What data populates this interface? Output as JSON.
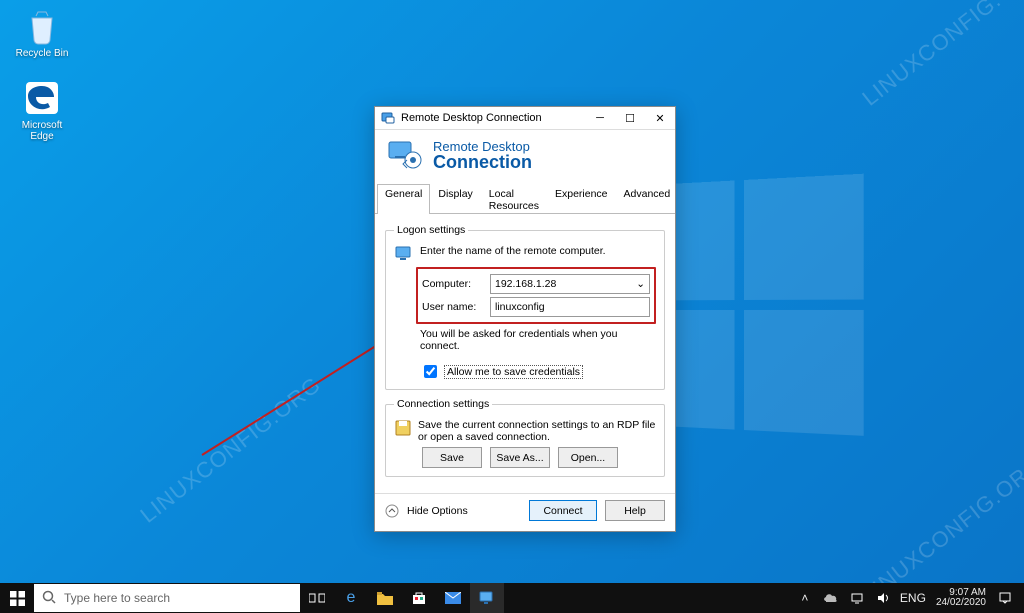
{
  "watermark": "LINUXCONFIG.ORG",
  "desktop_icons": [
    {
      "name": "Recycle Bin"
    },
    {
      "name": "Microsoft Edge"
    }
  ],
  "window": {
    "title": "Remote Desktop Connection",
    "banner_line1": "Remote Desktop",
    "banner_line2": "Connection",
    "tabs": [
      "General",
      "Display",
      "Local Resources",
      "Experience",
      "Advanced"
    ],
    "logon": {
      "legend": "Logon settings",
      "instr": "Enter the name of the remote computer.",
      "computer_label": "Computer:",
      "computer_value": "192.168.1.28",
      "user_label": "User name:",
      "user_value": "linuxconfig",
      "note": "You will be asked for credentials when you connect.",
      "allow_save": "Allow me to save credentials"
    },
    "conn": {
      "legend": "Connection settings",
      "text": "Save the current connection settings to an RDP file or open a saved connection.",
      "save": "Save",
      "save_as": "Save As...",
      "open": "Open..."
    },
    "footer": {
      "hide_options": "Hide Options",
      "connect": "Connect",
      "help": "Help"
    }
  },
  "taskbar": {
    "search_placeholder": "Type here to search",
    "tray_lang": "ENG",
    "clock_time": "9:07 AM",
    "clock_date": "24/02/2020"
  }
}
